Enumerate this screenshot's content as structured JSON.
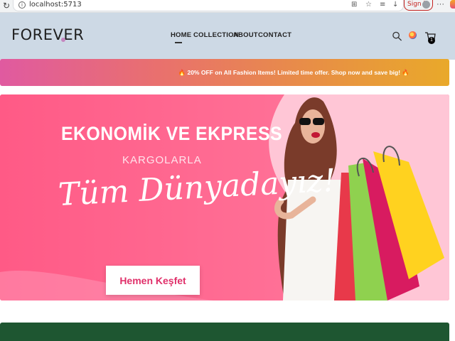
{
  "browser": {
    "url": "localhost:5713",
    "sign_in_label": "Sign in",
    "more_label": "···"
  },
  "nav": {
    "logo": "FOREVER",
    "items": [
      {
        "label": "HOME",
        "active": true
      },
      {
        "label": "COLLECTION",
        "active": false
      },
      {
        "label": "ABOUT",
        "active": false
      },
      {
        "label": "CONTACT",
        "active": false
      }
    ],
    "cart_count": "1",
    "icons": [
      "search-icon",
      "profile-icon",
      "cart-icon"
    ]
  },
  "promo": {
    "text": "🔥 20% OFF on All Fashion Items! Limited time offer. Shop now and save big! 🔥"
  },
  "hero": {
    "title": "EKONOMİK VE EKPRESS",
    "subtitle": "KARGOLARLA",
    "script_text": "Tüm Dünyadayız!",
    "button_label": "Hemen Keşfet"
  },
  "colors": {
    "nav_bg": "#cdd9e5",
    "hero_pink": "#ff5f8c",
    "promo_start": "#e05aa0",
    "promo_end": "#e9a92a",
    "footer_green": "#1e5631",
    "button_text": "#e0306a"
  }
}
